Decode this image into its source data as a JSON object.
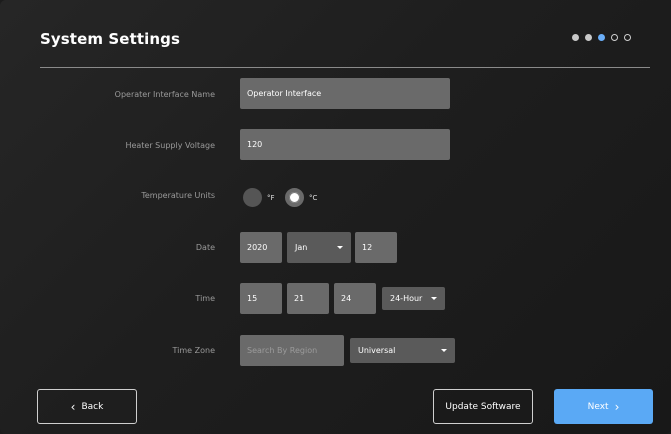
{
  "header": {
    "title": "System Settings",
    "pager": [
      "done",
      "done",
      "current",
      "todo",
      "todo"
    ]
  },
  "form": {
    "interface_name": {
      "label": "Operater Interface Name",
      "value": "Operator Interface"
    },
    "heater_voltage": {
      "label": "Heater Supply Voltage",
      "value": "120"
    },
    "temperature_units": {
      "label": "Temperature Units",
      "options": [
        {
          "label": "°F",
          "selected": false
        },
        {
          "label": "°C",
          "selected": true
        }
      ]
    },
    "date": {
      "label": "Date",
      "year": "2020",
      "month": "Jan",
      "day": "12"
    },
    "time": {
      "label": "Time",
      "hours": "15",
      "minutes": "21",
      "seconds": "24",
      "format": "24-Hour"
    },
    "time_zone": {
      "label": "Time Zone",
      "search_placeholder": "Search By Region",
      "zone": "Universal"
    }
  },
  "footer": {
    "back_label": "Back",
    "update_label": "Update Software",
    "next_label": "Next"
  },
  "colors": {
    "accent": "#5aa9f5",
    "page_dot_current": "#6aaef8",
    "field_bg": "#6a6a6a",
    "background": "#1c1c1c"
  }
}
